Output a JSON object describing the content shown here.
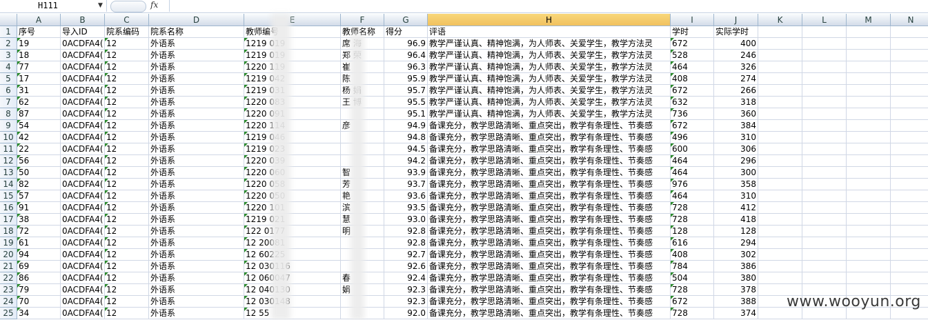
{
  "formula_bar": {
    "name_box": "H111",
    "fx_label": "fx",
    "formula": ""
  },
  "columns": [
    "A",
    "B",
    "C",
    "D",
    "E",
    "F",
    "G",
    "H",
    "I",
    "J",
    "K",
    "L",
    "M",
    "N"
  ],
  "selected_column": "H",
  "header_row": [
    "序号",
    "导入ID",
    "院系编码",
    "院系名称",
    "教师编号",
    "教师名称",
    "得分",
    "评语",
    "学时",
    "实际学时",
    "",
    "",
    "",
    ""
  ],
  "rows": [
    [
      "19",
      "0ACDFA4(",
      "12",
      "外语系",
      "1219   019",
      "席  海",
      "96.9",
      "教学严谨认真、精神饱满，为人师表、关爱学生，教学方法灵",
      "672",
      "400"
    ],
    [
      "18",
      "0ACDFA4(",
      "12",
      "外语系",
      "1219   019",
      "郑  荣",
      "96.4",
      "教学严谨认真、精神饱满，为人师表、关爱学生，教学方法灵",
      "528",
      "246"
    ],
    [
      "77",
      "0ACDFA4(",
      "12",
      "外语系",
      "1220   119",
      "崔",
      "96.3",
      "教学严谨认真、精神饱满，为人师表、关爱学生，教学方法灵",
      "464",
      "326"
    ],
    [
      "17",
      "0ACDFA4(",
      "12",
      "外语系",
      "1219   042",
      "陈",
      "95.9",
      "教学严谨认真、精神饱满，为人师表、关爱学生，教学方法灵",
      "408",
      "274"
    ],
    [
      "31",
      "0ACDFA4(",
      "12",
      "外语系",
      "1219   031",
      "杨  娟",
      "95.7",
      "教学严谨认真、精神饱满，为人师表、关爱学生，教学方法灵",
      "672",
      "266"
    ],
    [
      "62",
      "0ACDFA4(",
      "12",
      "外语系",
      "1220   083",
      "王  博",
      "95.5",
      "教学严谨认真、精神饱满，为人师表、关爱学生，教学方法灵",
      "632",
      "318"
    ],
    [
      "87",
      "0ACDFA4(",
      "12",
      "外语系",
      "1220   091",
      "",
      "95.1",
      "教学严谨认真、精神饱满，为人师表、关爱学生，教学方法灵",
      "736",
      "360"
    ],
    [
      "54",
      "0ACDFA4(",
      "12",
      "外语系",
      "1220   114",
      "  彦",
      "94.9",
      "备课充分，教学思路清晰、重点突出，教学有条理性、节奏感",
      "672",
      "384"
    ],
    [
      "42",
      "0ACDFA4(",
      "12",
      "外语系",
      "1219   046",
      "",
      "94.8",
      "备课充分，教学思路清晰、重点突出，教学有条理性、节奏感",
      "496",
      "310"
    ],
    [
      "22",
      "0ACDFA4(",
      "12",
      "外语系",
      "1219   023",
      "",
      "94.5",
      "备课充分，教学思路清晰、重点突出，教学有条理性、节奏感",
      "600",
      "306"
    ],
    [
      "56",
      "0ACDFA4(",
      "12",
      "外语系",
      "1220   039",
      "",
      "94.2",
      "备课充分，教学思路清晰、重点突出，教学有条理性、节奏感",
      "464",
      "296"
    ],
    [
      "50",
      "0ACDFA4(",
      "12",
      "外语系",
      "1220   060",
      "  智",
      "93.9",
      "备课充分，教学思路清晰、重点突出，教学有条理性、节奏感",
      "464",
      "300"
    ],
    [
      "82",
      "0ACDFA4(",
      "12",
      "外语系",
      "1220   058",
      "  芳",
      "93.7",
      "备课充分，教学思路清晰、重点突出，教学有条理性、节奏感",
      "976",
      "358"
    ],
    [
      "57",
      "0ACDFA4(",
      "12",
      "外语系",
      "1220   050",
      "  艳",
      "93.6",
      "备课充分，教学思路清晰、重点突出，教学有条理性、节奏感",
      "464",
      "310"
    ],
    [
      "91",
      "0ACDFA4(",
      "12",
      "外语系",
      "1220   101",
      "  滨",
      "93.5",
      "备课充分，教学思路清晰、重点突出，教学有条理性、节奏感",
      "728",
      "412"
    ],
    [
      "38",
      "0ACDFA4(",
      "12",
      "外语系",
      "1219   021",
      "  慧",
      "93.0",
      "备课充分，教学思路清晰、重点突出，教学有条理性、节奏感",
      "728",
      "418"
    ],
    [
      "72",
      "0ACDFA4(",
      "12",
      "外语系",
      "122   0177",
      "  明",
      "92.8",
      "备课充分，教学思路清晰、重点突出，教学有条理性、节奏感",
      "128",
      "128"
    ],
    [
      "61",
      "0ACDFA4(",
      "12",
      "外语系",
      "12   20081",
      "",
      "92.8",
      "备课充分，教学思路清晰、重点突出，教学有条理性、节奏感",
      "616",
      "294"
    ],
    [
      "94",
      "0ACDFA4(",
      "12",
      "外语系",
      "12   60225",
      "",
      "92.7",
      "备课充分，教学思路清晰、重点突出，教学有条理性、节奏感",
      "408",
      "302"
    ],
    [
      "69",
      "0ACDFA4(",
      "12",
      "外语系",
      "12   030116",
      "",
      "92.6",
      "备课充分，教学思路清晰、重点突出，教学有条理性、节奏感",
      "784",
      "386"
    ],
    [
      "86",
      "0ACDFA4(",
      "12",
      "外语系",
      "12   060047",
      "  春",
      "92.4",
      "备课充分，教学思路清晰、重点突出，教学有条理性、节奏感",
      "504",
      "380"
    ],
    [
      "79",
      "0ACDFA4(",
      "12",
      "外语系",
      "12   040130",
      "  娟",
      "92.3",
      "备课充分，教学思路清晰、重点突出，教学有条理性、节奏感",
      "728",
      "378"
    ],
    [
      "70",
      "0ACDFA4(",
      "12",
      "外语系",
      "12   030148",
      "",
      "92.3",
      "备课充分，教学思路清晰、重点突出，教学有条理性、节奏感",
      "672",
      "388"
    ],
    [
      "34",
      "0ACDFA4(",
      "12",
      "外语系",
      "12   55",
      "",
      "92.0",
      "备课充分，教学思路清晰、重点突出，教学有条理性、节奏感",
      "728",
      "374"
    ]
  ],
  "watermark": "www.wooyun.org"
}
